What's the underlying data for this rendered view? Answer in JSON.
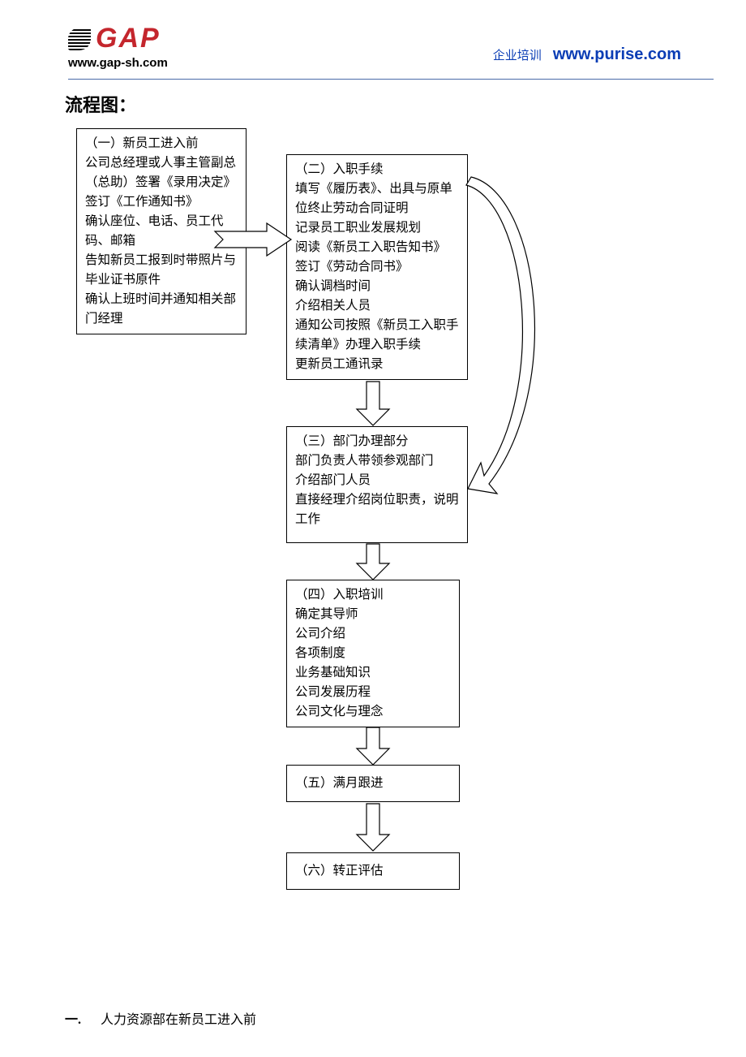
{
  "header": {
    "logo_text": "GAP",
    "logo_url": "www.gap-sh.com",
    "category": "企业培训",
    "right_link": "www.purise.com"
  },
  "title": "流程图：",
  "boxes": {
    "b1": {
      "title": "（一）新员工进入前",
      "lines": [
        "公司总经理或人事主管副总（总助）签署《录用决定》",
        "签订《工作通知书》",
        "确认座位、电话、员工代码、邮箱",
        "告知新员工报到时带照片与毕业证书原件",
        "确认上班时间并通知相关部门经理"
      ]
    },
    "b2": {
      "title": "（二）入职手续",
      "lines": [
        "填写《履历表》、出具与原单位终止劳动合同证明",
        "记录员工职业发展规划",
        "阅读《新员工入职告知书》",
        "签订《劳动合同书》",
        "确认调档时间",
        "介绍相关人员",
        "通知公司按照《新员工入职手续清单》办理入职手续",
        "更新员工通讯录"
      ]
    },
    "b3": {
      "title": "（三）部门办理部分",
      "lines": [
        "部门负责人带领参观部门",
        "介绍部门人员",
        "直接经理介绍岗位职责，说明工作"
      ]
    },
    "b4": {
      "title": "（四）入职培训",
      "lines": [
        "确定其导师",
        "公司介绍",
        "各项制度",
        "业务基础知识",
        "公司发展历程",
        "公司文化与理念"
      ]
    },
    "b5": {
      "title": "（五）满月跟进"
    },
    "b6": {
      "title": "（六）转正评估"
    }
  },
  "footer": {
    "num": "一.",
    "text": "人力资源部在新员工进入前"
  }
}
